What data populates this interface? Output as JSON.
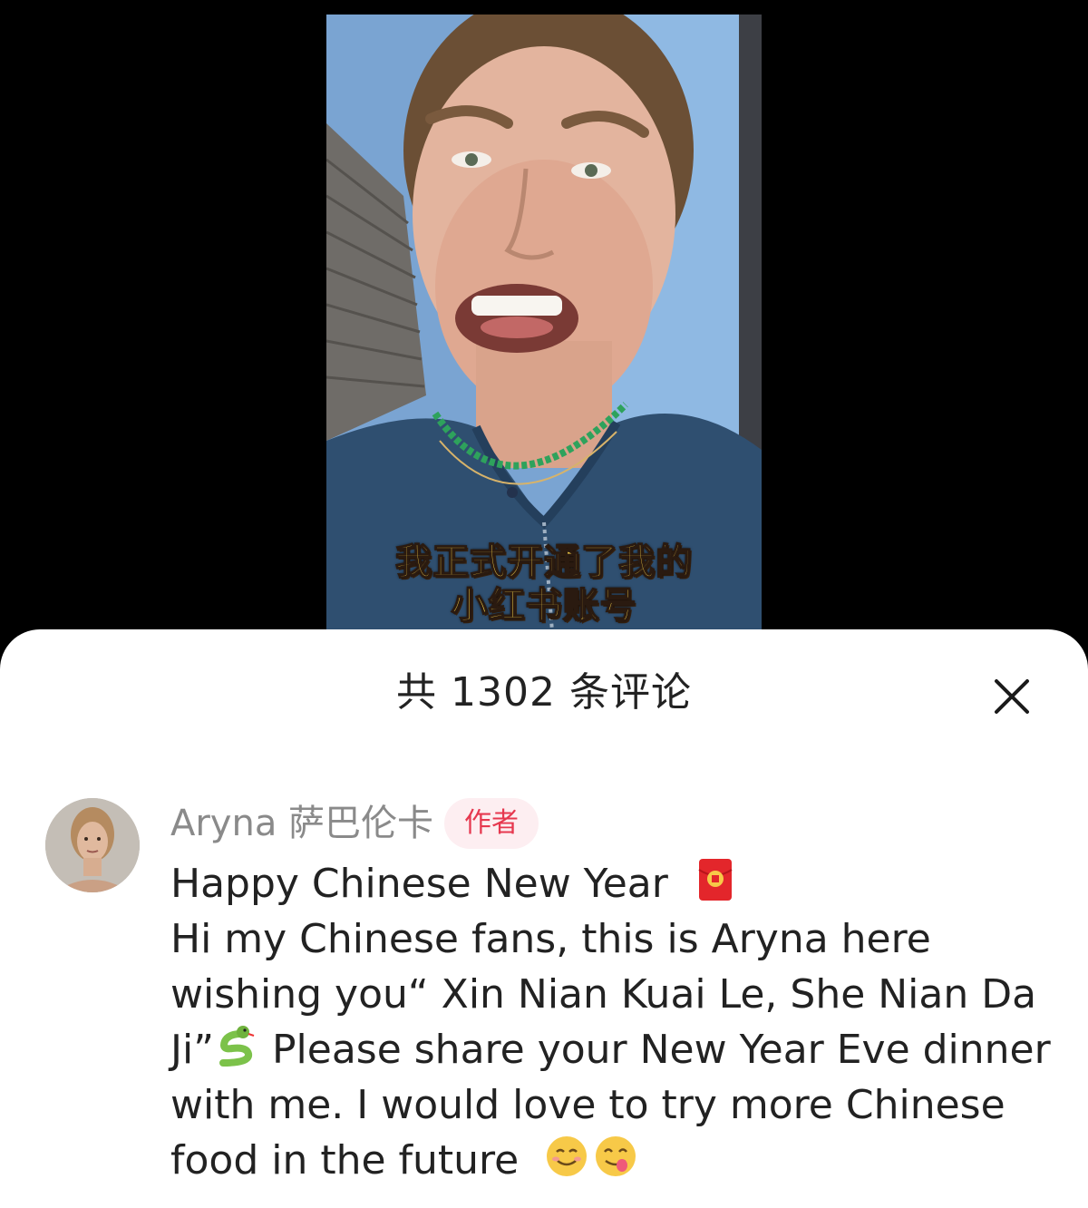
{
  "video": {
    "subtitle_line1": "我正式开通了我的",
    "subtitle_line2": "小红书账号"
  },
  "comments_panel": {
    "title": "共 1302 条评论",
    "close_icon": "close-icon"
  },
  "comment": {
    "author": "Aryna 萨巴伦卡",
    "badge": "作者",
    "lines": [
      "Happy Chinese New Year",
      "Hi my Chinese fans, this is Aryna here",
      "wishing you“ Xin Nian Kuai Le, She Nian Da",
      "Ji”",
      " Please share your New Year Eve dinner",
      "with me. I would love to try more Chinese",
      "food in the future"
    ],
    "icons": [
      "red-envelope-icon",
      "snake-icon",
      "smiling-face-icon",
      "yum-face-icon"
    ]
  },
  "colors": {
    "badge_text": "#e6384f",
    "badge_bg": "#fdeef1",
    "subtitle": "#f7d24a"
  }
}
